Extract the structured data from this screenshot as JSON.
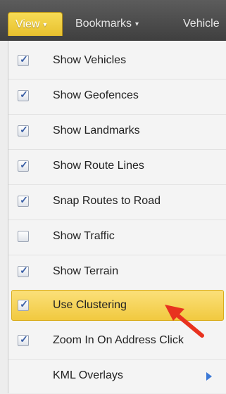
{
  "topbar": {
    "view_label": "View",
    "bookmarks_label": "Bookmarks",
    "vehicles_label": "Vehicle",
    "caret": "▾"
  },
  "menu": {
    "items": [
      {
        "label": "Show Vehicles",
        "checked": true
      },
      {
        "label": "Show Geofences",
        "checked": true
      },
      {
        "label": "Show Landmarks",
        "checked": true
      },
      {
        "label": "Show Route Lines",
        "checked": true
      },
      {
        "label": "Snap Routes to Road",
        "checked": true
      },
      {
        "label": "Show Traffic",
        "checked": false
      },
      {
        "label": "Show Terrain",
        "checked": true
      },
      {
        "label": "Use Clustering",
        "checked": true,
        "highlighted": true
      },
      {
        "label": "Zoom In On Address Click",
        "checked": true
      },
      {
        "label": "KML Overlays",
        "submenu": true
      }
    ]
  },
  "colors": {
    "accent_yellow": "#f1c93f",
    "arrow_red": "#e8321f",
    "submenu_arrow": "#3b78d6"
  },
  "icons": {
    "check": "✓",
    "submenu": "triangle-right-icon",
    "annotation": "red-arrow-icon"
  }
}
